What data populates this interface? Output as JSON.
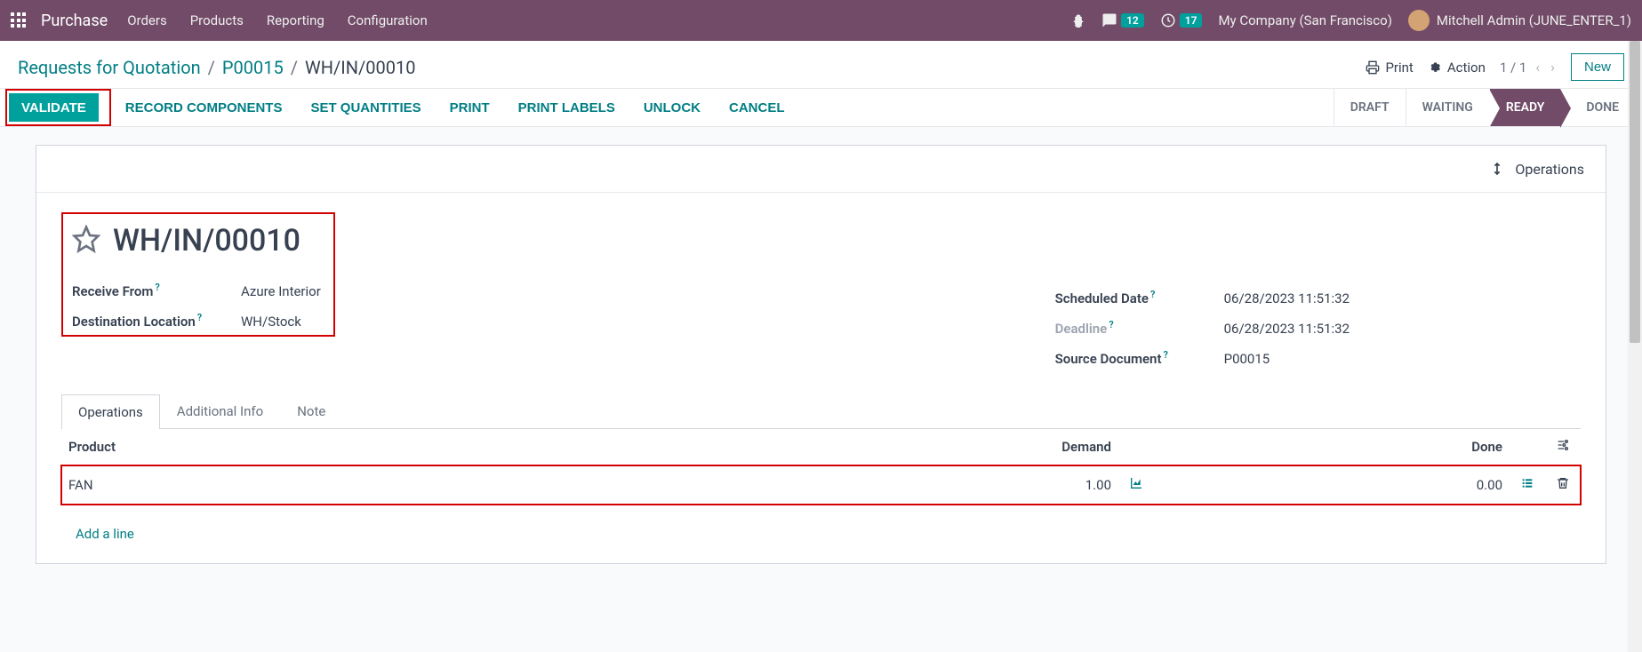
{
  "navbar": {
    "brand": "Purchase",
    "menu": [
      "Orders",
      "Products",
      "Reporting",
      "Configuration"
    ],
    "messages_count": "12",
    "activities_count": "17",
    "company": "My Company (San Francisco)",
    "user": "Mitchell Admin (JUNE_ENTER_1)"
  },
  "breadcrumb": {
    "root": "Requests for Quotation",
    "parent": "P00015",
    "current": "WH/IN/00010"
  },
  "header": {
    "print": "Print",
    "action": "Action",
    "pager": "1 / 1",
    "new": "New"
  },
  "actions": {
    "validate": "VALIDATE",
    "record_components": "RECORD COMPONENTS",
    "set_quantities": "SET QUANTITIES",
    "print": "PRINT",
    "print_labels": "PRINT LABELS",
    "unlock": "UNLOCK",
    "cancel": "CANCEL"
  },
  "status": [
    "DRAFT",
    "WAITING",
    "READY",
    "DONE"
  ],
  "status_active": "READY",
  "operations_btn": "Operations",
  "record": {
    "title": "WH/IN/00010",
    "fields_left": {
      "receive_from_label": "Receive From",
      "receive_from_value": "Azure Interior",
      "dest_loc_label": "Destination Location",
      "dest_loc_value": "WH/Stock"
    },
    "fields_right": {
      "sched_label": "Scheduled Date",
      "sched_value": "06/28/2023 11:51:32",
      "deadline_label": "Deadline",
      "deadline_value": "06/28/2023 11:51:32",
      "source_label": "Source Document",
      "source_value": "P00015"
    }
  },
  "tabs": [
    "Operations",
    "Additional Info",
    "Note"
  ],
  "table": {
    "headers": {
      "product": "Product",
      "demand": "Demand",
      "done": "Done"
    },
    "row": {
      "product": "FAN",
      "demand": "1.00",
      "done": "0.00"
    },
    "add_line": "Add a line"
  }
}
